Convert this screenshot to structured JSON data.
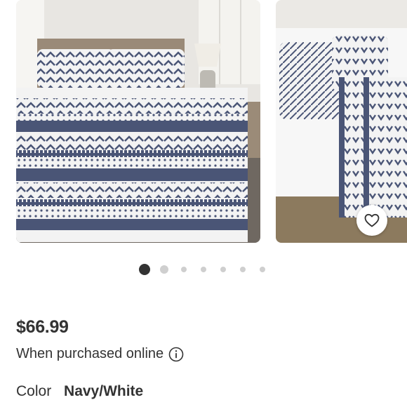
{
  "product": {
    "images": [
      {
        "name": "comforter-set-bedroom-photo",
        "alt": ""
      },
      {
        "name": "comforter-pillow-closeup-photo",
        "alt": ""
      }
    ],
    "favorite_icon": "heart-outline-icon",
    "carousel": {
      "total_slides": 7,
      "active_index": 0
    },
    "price": "$66.99",
    "price_note": "When purchased online",
    "info_icon": "info-circle-icon",
    "color_label": "Color",
    "color_value": "Navy/White"
  },
  "colors": {
    "text": "#333333",
    "dot_active": "#333333",
    "dot_inactive": "#cfcfcf",
    "pattern_navy": "#4a5576",
    "pattern_white": "#f3f3f3"
  }
}
